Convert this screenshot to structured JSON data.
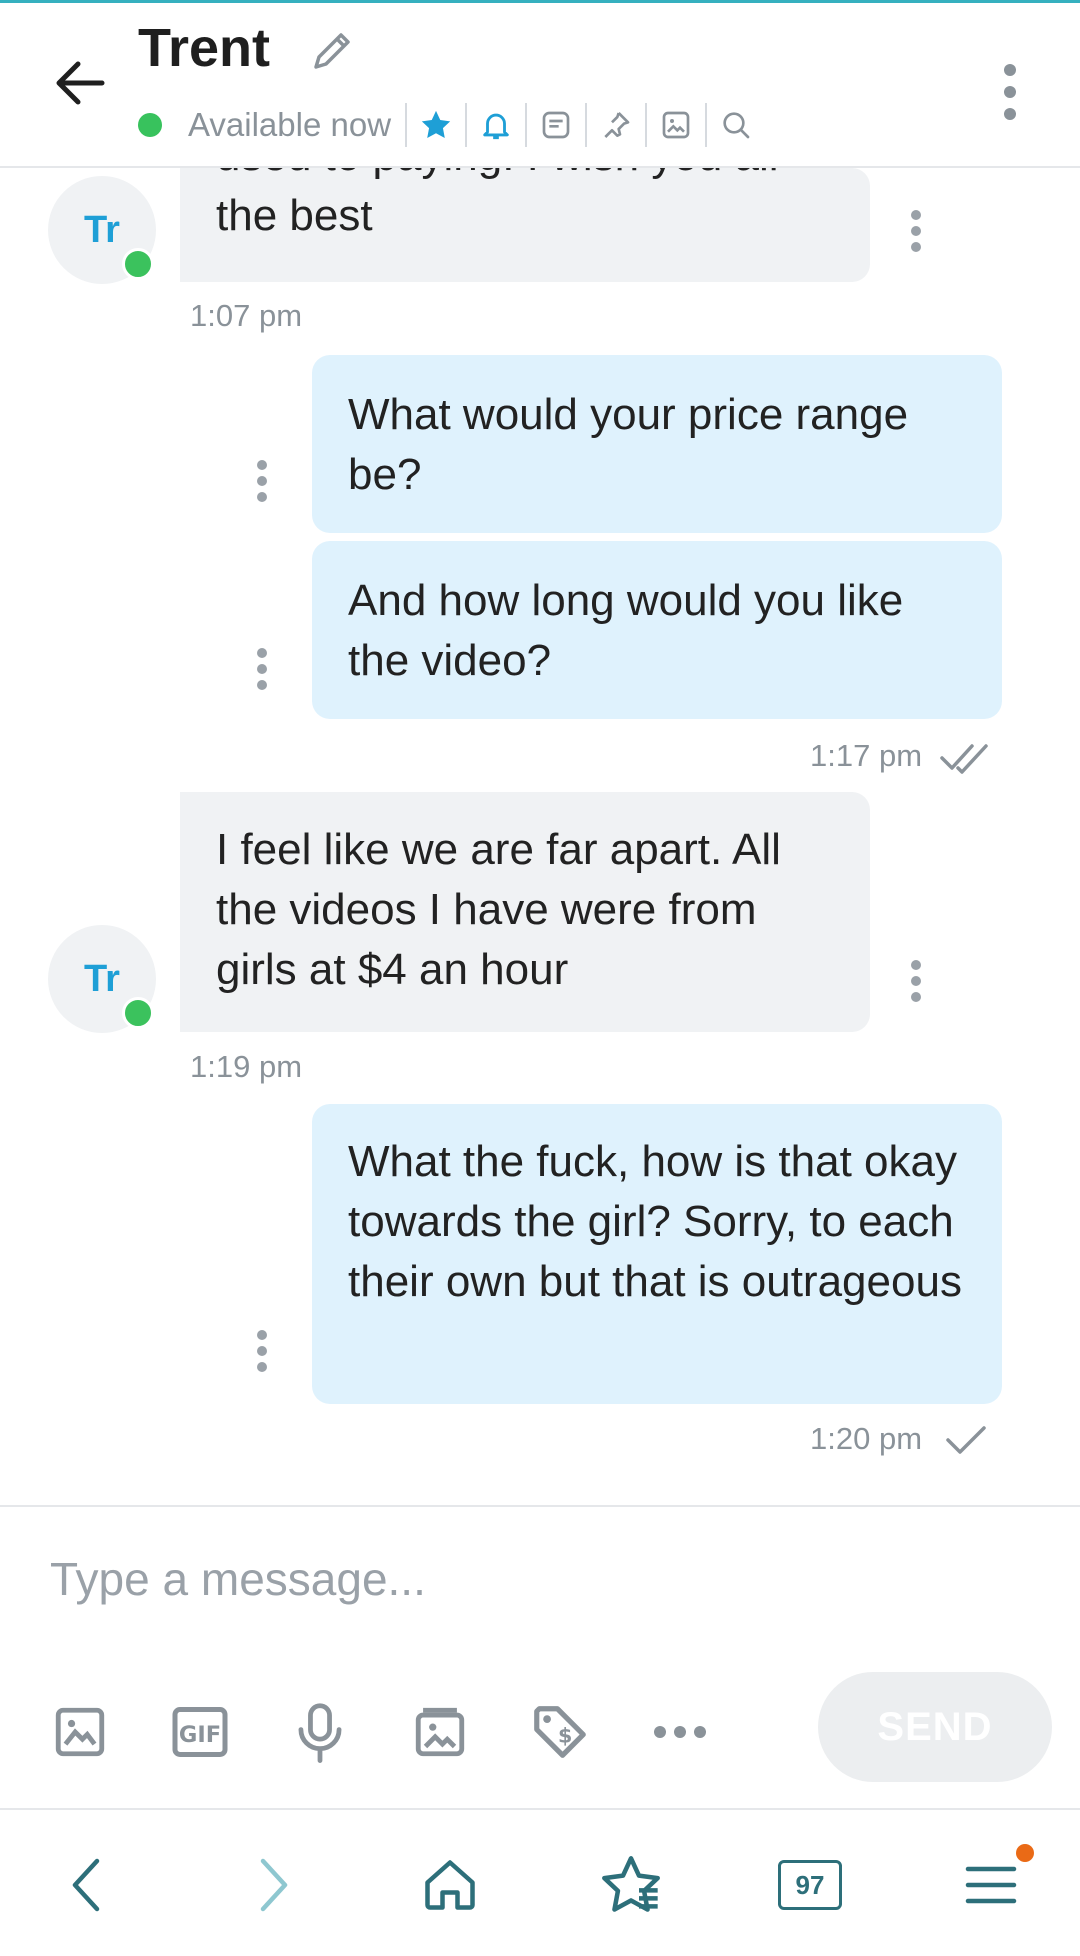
{
  "header": {
    "title": "Trent",
    "status": "Available now",
    "accent": "#1e9fd6",
    "status_color": "#38c25d",
    "icons": [
      "star-icon",
      "bell-icon",
      "note-icon",
      "pin-icon",
      "image-icon",
      "search-icon"
    ]
  },
  "messages": [
    {
      "from": "Trent",
      "avatar": "Tr",
      "text_top_partial": "used to paying. I wish you all",
      "text": "the best",
      "time": "1:07 pm"
    },
    {
      "from": "me",
      "text": "What would your price range be?"
    },
    {
      "from": "me",
      "text": "And how long would you like the video?",
      "time": "1:17 pm",
      "receipt": "read-double-check"
    },
    {
      "from": "Trent",
      "avatar": "Tr",
      "text": "I feel like we are far apart. All the videos I have were from girls at $4 an hour",
      "time": "1:19 pm"
    },
    {
      "from": "me",
      "text": "What the fuck, how is that okay towards the girl? Sorry, to each their own but that is outrageous",
      "time": "1:20 pm",
      "receipt": "sent-single-check"
    }
  ],
  "composer": {
    "placeholder": "Type a message...",
    "send_label": "SEND",
    "tools": [
      "image-icon",
      "gif-icon",
      "microphone-icon",
      "vault-icon",
      "price-tag-icon",
      "more-icon"
    ]
  },
  "browser_nav": {
    "tabs_count": "97",
    "items": [
      "back-icon",
      "forward-icon",
      "home-icon",
      "bookmarks-icon",
      "tabs-icon",
      "menu-icon"
    ]
  }
}
